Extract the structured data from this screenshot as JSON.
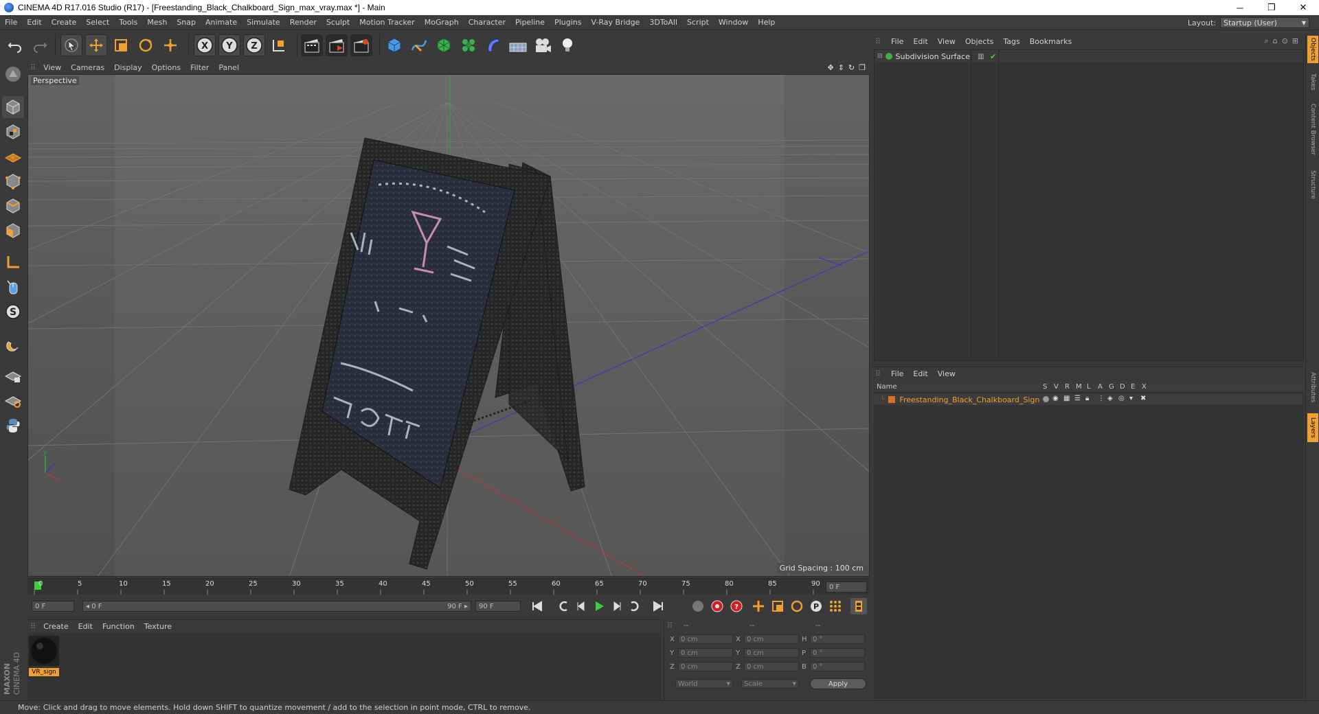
{
  "window": {
    "title": "CINEMA 4D R17.016 Studio (R17) - [Freestanding_Black_Chalkboard_Sign_max_vray.max *] - Main",
    "minimize": "─",
    "maximize": "❐",
    "close": "✕"
  },
  "menubar": {
    "items": [
      "File",
      "Edit",
      "Create",
      "Select",
      "Tools",
      "Mesh",
      "Snap",
      "Animate",
      "Simulate",
      "Render",
      "Sculpt",
      "Motion Tracker",
      "MoGraph",
      "Character",
      "Pipeline",
      "Plugins",
      "V-Ray Bridge",
      "3DToAll",
      "Script",
      "Window",
      "Help"
    ],
    "layout_label": "Layout:",
    "layout_value": "Startup (User)"
  },
  "viewport": {
    "menu": [
      "View",
      "Cameras",
      "Display",
      "Options",
      "Filter",
      "Panel"
    ],
    "label": "Perspective",
    "grid_spacing": "Grid Spacing : 100 cm"
  },
  "timeline": {
    "ticks": [
      "0",
      "5",
      "10",
      "15",
      "20",
      "25",
      "30",
      "35",
      "40",
      "45",
      "50",
      "55",
      "60",
      "65",
      "70",
      "75",
      "80",
      "85",
      "90"
    ],
    "current_frame": "0 F"
  },
  "transport": {
    "start_field": "0 F",
    "range_start": "◂ 0 F",
    "range_end": "90 F ▸",
    "end_field": "90 F"
  },
  "material_manager": {
    "menu": [
      "Create",
      "Edit",
      "Function",
      "Texture"
    ],
    "materials": [
      {
        "name": "VR_sign"
      }
    ]
  },
  "coordinates": {
    "header": [
      "--",
      "--",
      "--"
    ],
    "rows": [
      {
        "axis": "X",
        "pos": "0 cm",
        "axis2": "X",
        "size": "0 cm",
        "rot_label": "H",
        "rot": "0 °"
      },
      {
        "axis": "Y",
        "pos": "0 cm",
        "axis2": "Y",
        "size": "0 cm",
        "rot_label": "P",
        "rot": "0 °"
      },
      {
        "axis": "Z",
        "pos": "0 cm",
        "axis2": "Z",
        "size": "0 cm",
        "rot_label": "B",
        "rot": "0 °"
      }
    ],
    "mode_world": "World",
    "mode_scale": "Scale",
    "apply": "Apply"
  },
  "object_manager": {
    "menu": [
      "File",
      "Edit",
      "View",
      "Objects",
      "Tags",
      "Bookmarks"
    ],
    "objects": [
      {
        "name": "Subdivision Surface"
      }
    ]
  },
  "layer_manager": {
    "menu": [
      "File",
      "Edit",
      "View"
    ],
    "columns": [
      "Name",
      "S",
      "V",
      "R",
      "M",
      "L",
      "A",
      "G",
      "D",
      "E",
      "X"
    ],
    "layers": [
      {
        "name": "Freestanding_Black_Chalkboard_Sign",
        "color": "#e07020"
      }
    ]
  },
  "right_tabs": [
    "Objects",
    "Takes",
    "Content Browser",
    "Structure",
    "Attributes",
    "Layers"
  ],
  "status": "Move: Click and drag to move elements. Hold down SHIFT to quantize movement / add to the selection in point mode, CTRL to remove.",
  "logo": {
    "line1": "MAXON",
    "line2": "CINEMA 4D"
  },
  "colors": {
    "accent": "#f0a030",
    "play_green": "#3cd03c",
    "record_red": "#d02020",
    "layer_text": "#f0a030"
  }
}
